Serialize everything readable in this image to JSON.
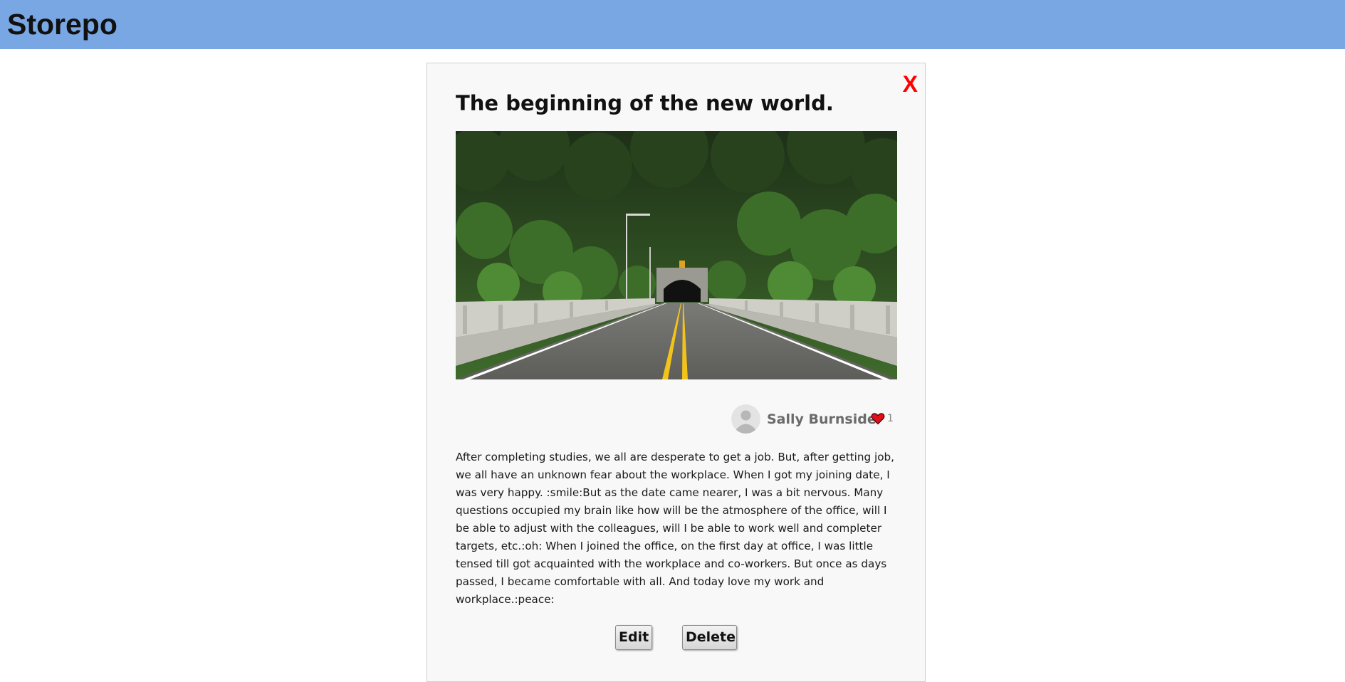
{
  "header": {
    "brand": "Storepo",
    "background_color": "#78a7e3"
  },
  "story": {
    "close_label": "X",
    "close_color": "#ff0000",
    "title": "The beginning of the new world.",
    "image_subject": "road-bridge-leading-into-forest-tunnel",
    "author": {
      "name": "Sally Burnside",
      "avatar_icon": "default-user-avatar-icon"
    },
    "likes": {
      "icon": "heart-icon",
      "color": "#e0101b",
      "count": "1"
    },
    "body": "After completing studies, we all are desperate to get a job. But, after getting job, we all have an unknown fear about the workplace. When I got my joining date, I was very happy. :smile:But as the date came nearer, I was a bit nervous. Many questions occupied my brain like how will be the atmosphere of the office, will I be able to adjust with the colleagues, will I be able to work well and completer targets, etc.:oh: When I joined the office, on the first day at office, I was little tensed till got acquainted with the workplace and co-workers. But once as days passed, I became comfortable with all. And today love my work and workplace.:peace:",
    "actions": {
      "edit_label": "Edit",
      "delete_label": "Delete"
    }
  }
}
